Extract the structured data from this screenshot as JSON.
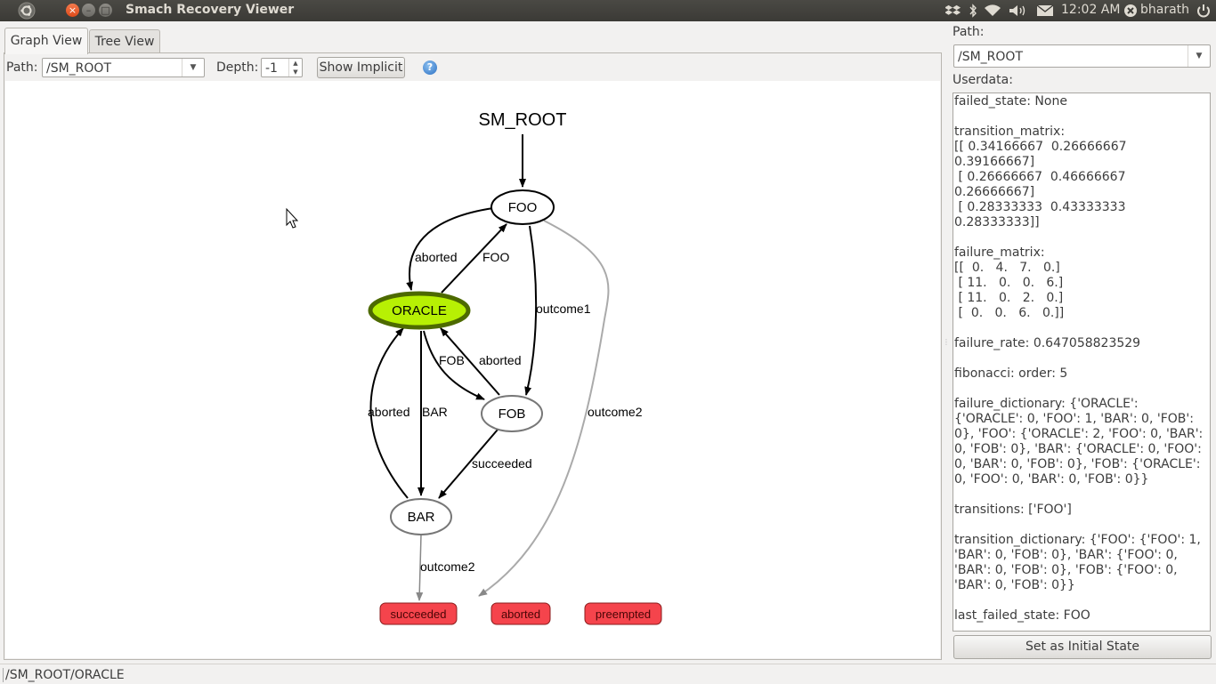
{
  "window": {
    "title": "Smach Recovery Viewer",
    "close_glyph": "×",
    "minimize_glyph": "–",
    "maximize_glyph": "□"
  },
  "tray": {
    "time": "12:02 AM",
    "user": "bharath",
    "icons": [
      "dropbox-icon",
      "bluetooth-icon",
      "wifi-icon",
      "volume-icon",
      "mail-icon",
      "user-icon",
      "power-icon"
    ]
  },
  "tabs": [
    {
      "label": "Graph View",
      "active": true
    },
    {
      "label": "Tree View",
      "active": false
    }
  ],
  "toolbar": {
    "path_label": "Path:",
    "path_value": "/SM_ROOT",
    "depth_label": "Depth:",
    "depth_value": "-1",
    "show_implicit_label": "Show Implicit",
    "help_glyph": "?"
  },
  "graph": {
    "root_label": "SM_ROOT",
    "nodes": {
      "foo": "FOO",
      "oracle": "ORACLE",
      "fob": "FOB",
      "bar": "BAR"
    },
    "outcomes": {
      "succeeded": "succeeded",
      "aborted": "aborted",
      "preempted": "preempted"
    },
    "edge_labels": {
      "foo_aborted": "aborted",
      "oracle_foo": "FOO",
      "foo_outcome1": "outcome1",
      "foo_outcome2": "outcome2",
      "oracle_fob": "FOB",
      "fob_aborted": "aborted",
      "bar_aborted": "aborted",
      "oracle_bar": "BAR",
      "fob_succeeded": "succeeded",
      "bar_outcome2": "outcome2"
    },
    "colors": {
      "active_fill": "#b7f004",
      "active_stroke": "#4d6a00",
      "outcome_fill": "#f5444c",
      "outcome_stroke": "#8a1d1d",
      "implicit_edge": "#aaaaaa"
    }
  },
  "right_panel": {
    "path_label": "Path:",
    "path_value": "/SM_ROOT",
    "userdata_label": "Userdata:",
    "userdata_text": "failed_state: None\n\ntransition_matrix:\n[[ 0.34166667  0.26666667  0.39166667]\n [ 0.26666667  0.46666667  0.26666667]\n [ 0.28333333  0.43333333  0.28333333]]\n\nfailure_matrix:\n[[  0.   4.   7.   0.]\n [ 11.   0.   0.   6.]\n [ 11.   0.   2.   0.]\n [  0.   0.   6.   0.]]\n\nfailure_rate: 0.647058823529\n\nfibonacci: order: 5\n\nfailure_dictionary: {'ORACLE': {'ORACLE': 0, 'FOO': 1, 'BAR': 0, 'FOB': 0}, 'FOO': {'ORACLE': 2, 'FOO': 0, 'BAR': 0, 'FOB': 0}, 'BAR': {'ORACLE': 0, 'FOO': 0, 'BAR': 0, 'FOB': 0}, 'FOB': {'ORACLE': 0, 'FOO': 0, 'BAR': 0, 'FOB': 0}}\n\ntransitions: ['FOO']\n\ntransition_dictionary: {'FOO': {'FOO': 1, 'BAR': 0, 'FOB': 0}, 'BAR': {'FOO': 0, 'BAR': 0, 'FOB': 0}, 'FOB': {'FOO': 0, 'BAR': 0, 'FOB': 0}}\n\nlast_failed_state: FOO",
    "set_initial_label": "Set as Initial State"
  },
  "status": {
    "text": "/SM_ROOT/ORACLE"
  }
}
